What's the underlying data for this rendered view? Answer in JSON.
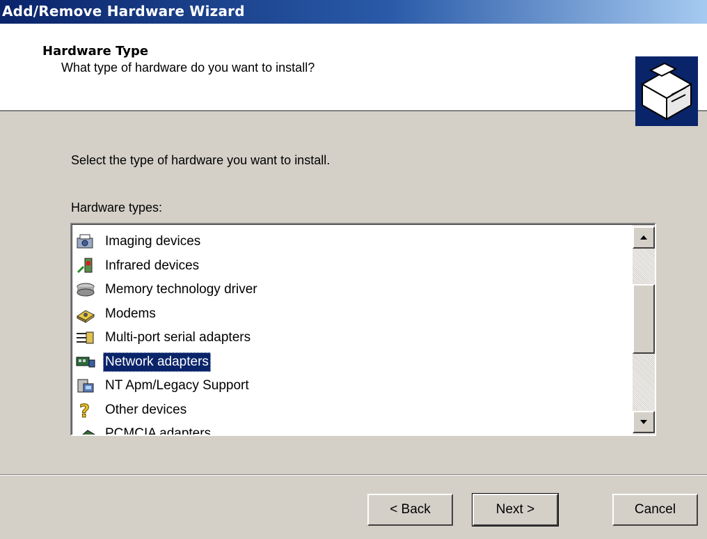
{
  "window": {
    "title": "Add/Remove Hardware Wizard"
  },
  "header": {
    "heading": "Hardware Type",
    "subheading": "What type of hardware do you want to install?",
    "icon": "hardware-box-icon"
  },
  "main": {
    "instruction": "Select the type of hardware you want to install.",
    "list_label": "Hardware types:",
    "items": [
      {
        "label": "Imaging devices",
        "icon": "imaging-icon"
      },
      {
        "label": "Infrared devices",
        "icon": "infrared-icon"
      },
      {
        "label": "Memory technology driver",
        "icon": "memory-driver-icon"
      },
      {
        "label": "Modems",
        "icon": "modem-icon"
      },
      {
        "label": "Multi-port serial adapters",
        "icon": "multiport-serial-icon"
      },
      {
        "label": "Network adapters",
        "icon": "network-adapter-icon",
        "selected": true
      },
      {
        "label": "NT Apm/Legacy Support",
        "icon": "legacy-support-icon"
      },
      {
        "label": "Other devices",
        "icon": "question-mark-icon"
      },
      {
        "label": "PCMCIA adapters",
        "icon": "pcmcia-icon"
      }
    ],
    "selected_item": "Network adapters"
  },
  "buttons": {
    "back": "< Back",
    "next": "Next >",
    "cancel": "Cancel"
  },
  "colors": {
    "title_bar_start": "#0a246a",
    "title_bar_end": "#a6caf0",
    "selection": "#0a246a",
    "dialog_face": "#d4d0c8"
  }
}
